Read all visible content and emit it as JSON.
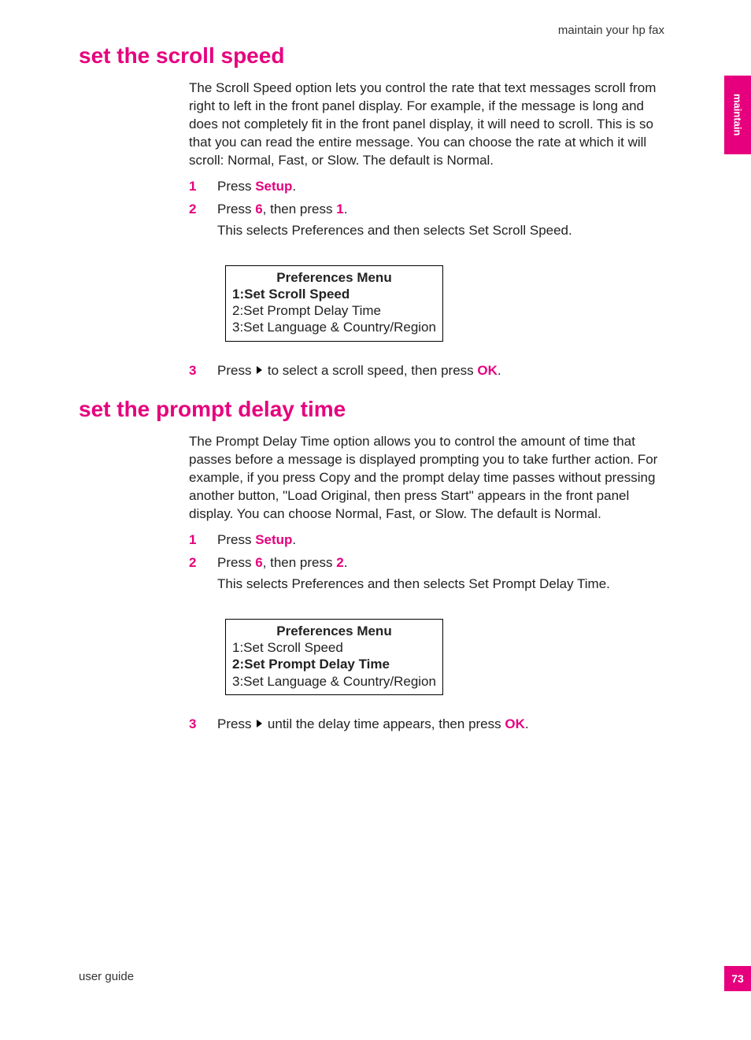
{
  "header": {
    "top_right": "maintain your hp fax"
  },
  "side_tabs": {
    "label": "maintain",
    "page_num": "73"
  },
  "section1": {
    "title": "set the scroll speed",
    "intro": "The Scroll Speed option lets you control the rate that text messages scroll from right to left in the front panel display. For example, if the message is long and does not completely fit in the front panel display, it will need to scroll. This is so that you can read the entire message. You can choose the rate at which it will scroll: Normal, Fast, or Slow. The default is Normal.",
    "step1_num": "1",
    "step1_a": "Press ",
    "step1_b": "Setup",
    "step1_c": ".",
    "step2_num": "2",
    "step2_a": "Press ",
    "step2_b": "6",
    "step2_c": ", then press ",
    "step2_d": "1",
    "step2_e": ".",
    "step2_sub": "This selects Preferences and then selects Set Scroll Speed.",
    "menu": {
      "title": "Preferences Menu",
      "i1": "1:Set Scroll Speed",
      "i2": "2:Set Prompt Delay Time",
      "i3": "3:Set Language & Country/Region"
    },
    "step3_num": "3",
    "step3_a": "Press ",
    "step3_b": " to select a scroll speed, then press ",
    "step3_c": "OK",
    "step3_d": "."
  },
  "section2": {
    "title": "set the prompt delay time",
    "intro": "The Prompt Delay Time option allows you to control the amount of time that passes before a message is displayed prompting you to take further action. For example, if you press Copy and the prompt delay time passes without pressing another button, \"Load Original, then press Start\" appears in the front panel display. You can choose Normal, Fast, or Slow. The default is Normal.",
    "step1_num": "1",
    "step1_a": "Press ",
    "step1_b": "Setup",
    "step1_c": ".",
    "step2_num": "2",
    "step2_a": "Press ",
    "step2_b": "6",
    "step2_c": ", then press ",
    "step2_d": "2",
    "step2_e": ".",
    "step2_sub": "This selects Preferences and then selects Set Prompt Delay Time.",
    "menu": {
      "title": "Preferences Menu",
      "i1": "1:Set Scroll Speed",
      "i2": "2:Set Prompt Delay Time",
      "i3": "3:Set Language & Country/Region"
    },
    "step3_num": "3",
    "step3_a": "Press ",
    "step3_b": " until the delay time appears, then press ",
    "step3_c": "OK",
    "step3_d": "."
  },
  "footer": {
    "left": "user guide"
  }
}
